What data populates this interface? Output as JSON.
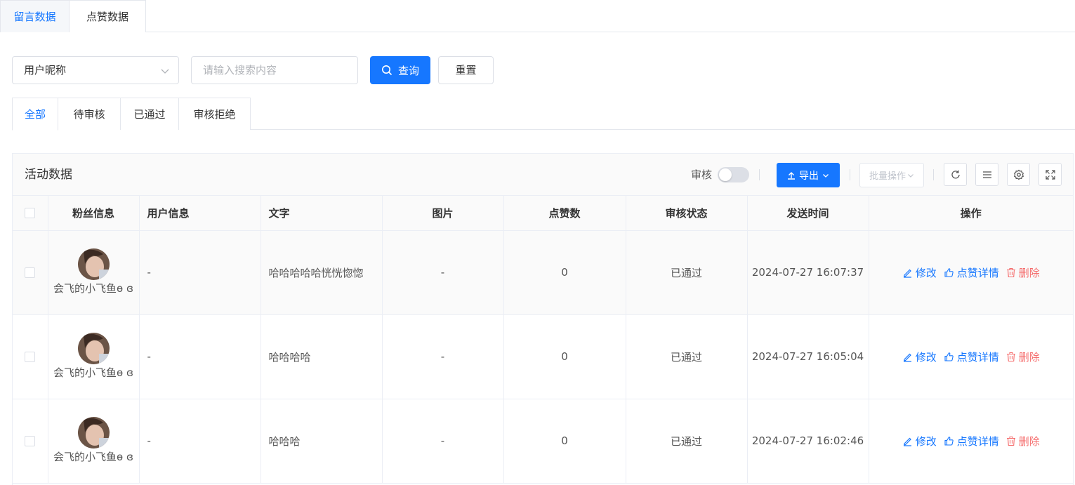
{
  "top_tabs": [
    {
      "label": "留言数据",
      "active": true
    },
    {
      "label": "点赞数据",
      "active": false
    }
  ],
  "search": {
    "field_select": "用户昵称",
    "placeholder": "请输入搜索内容",
    "query_label": "查询",
    "reset_label": "重置"
  },
  "status_tabs": [
    {
      "label": "全部",
      "active": true
    },
    {
      "label": "待审核"
    },
    {
      "label": "已通过"
    },
    {
      "label": "审核拒绝"
    }
  ],
  "panel": {
    "title": "活动数据",
    "audit_label": "审核",
    "audit_on": false,
    "export_label": "导出",
    "batch_label": "批量操作"
  },
  "table": {
    "columns": [
      "粉丝信息",
      "用户信息",
      "文字",
      "图片",
      "点赞数",
      "审核状态",
      "发送时间",
      "操作"
    ],
    "rows": [
      {
        "nickname": "会飞的小飞鱼ɵ ɞ",
        "user_info": "-",
        "text": "哈哈哈哈哈恍恍惚惚",
        "image": "-",
        "likes": "0",
        "status": "已通过",
        "time": "2024-07-27 16:07:37"
      },
      {
        "nickname": "会飞的小飞鱼ɵ ɞ",
        "user_info": "-",
        "text": "哈哈哈哈",
        "image": "-",
        "likes": "0",
        "status": "已通过",
        "time": "2024-07-27 16:05:04"
      },
      {
        "nickname": "会飞的小飞鱼ɵ ɞ",
        "user_info": "-",
        "text": "哈哈哈",
        "image": "-",
        "likes": "0",
        "status": "已通过",
        "time": "2024-07-27 16:02:46"
      }
    ],
    "actions": {
      "edit": "修改",
      "like_detail": "点赞详情",
      "delete": "删除"
    }
  },
  "colors": {
    "primary": "#1677ff",
    "danger": "#f56c6c",
    "border": "#ebeef5"
  },
  "icons": [
    "search-icon",
    "chevron-down-icon",
    "upload-icon",
    "refresh-icon",
    "column-list-icon",
    "settings-icon",
    "fullscreen-icon",
    "edit-icon",
    "thumb-up-icon",
    "trash-icon"
  ]
}
